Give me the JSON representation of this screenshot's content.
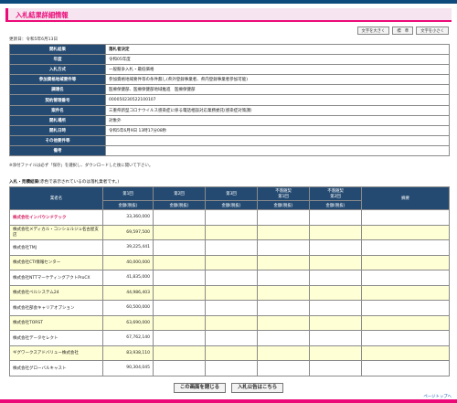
{
  "header": {
    "title": "入札結果詳細情報"
  },
  "font_controls": {
    "larger": "文字を大きく",
    "standard": "標　準",
    "smaller": "文字を小さく"
  },
  "updated": "更新日：令和5年6月13日",
  "info": [
    {
      "label": "開札結果",
      "value": "落札者決定",
      "bold": true
    },
    {
      "label": "年度",
      "value": "令和05年度"
    },
    {
      "label": "入札方式",
      "value": "一般競争入札・最低価格"
    },
    {
      "label": "参加資格地域要件等",
      "value": "参加資格地域要件等の条件無し(県外登録事業者、県内登録事業者参加可能)"
    },
    {
      "label": "調達名",
      "value": "医療保健部、医療保健部地域推進　医療保健部"
    },
    {
      "label": "契約管理番号",
      "value": "000050230522100107"
    },
    {
      "label": "案件名",
      "value": "三重県新型コロナウイルス感染症に係る電話相談対応業務委託(感染症対策課)"
    },
    {
      "label": "開札場所",
      "value": "対象外"
    },
    {
      "label": "開札日時",
      "value": "令和5年6月9日 13時17分08秒"
    },
    {
      "label": "その他要件等",
      "value": ""
    },
    {
      "label": "備考",
      "value": ""
    }
  ],
  "note": "※添付ファイルは必ず「保存」を選択し、ダウンロードした後に開いて下さい。",
  "bids_section": {
    "title": "入札・見積結果",
    "subtitle": "(赤色で表示されているのは落札業者です。)"
  },
  "bids_table": {
    "col_name": "業者名",
    "col_round1": "第1回",
    "col_round2": "第2回",
    "col_round3": "第3回",
    "col_neg1": "不落随契\n第1回",
    "col_neg2": "不落随契\n第2回",
    "col_notes": "摘要",
    "amount_label": "金額(税抜)"
  },
  "bids": [
    {
      "name": "株式会社インバウンドテック",
      "amount": "33,360,000",
      "winner": true,
      "yellow": false
    },
    {
      "name": "株式会社メディカル・コンシェルジュ名古屋支店",
      "amount": "69,597,500",
      "winner": false,
      "yellow": true
    },
    {
      "name": "株式会社TMJ",
      "amount": "39,225,441",
      "winner": false,
      "yellow": false
    },
    {
      "name": "株式会社CTI情報センター",
      "amount": "40,000,000",
      "winner": false,
      "yellow": true
    },
    {
      "name": "株式会社NTTマーケティングアクトProCX",
      "amount": "41,835,000",
      "winner": false,
      "yellow": false
    },
    {
      "name": "株式会社ベルシステム24",
      "amount": "44,986,403",
      "winner": false,
      "yellow": true
    },
    {
      "name": "株式会社部会キャリアオプション",
      "amount": "60,500,000",
      "winner": false,
      "yellow": false
    },
    {
      "name": "株式会社TORST",
      "amount": "63,690,000",
      "winner": false,
      "yellow": true
    },
    {
      "name": "株式会社データセレクト",
      "amount": "67,762,140",
      "winner": false,
      "yellow": false
    },
    {
      "name": "ギグワークスアドバリュー株式会社",
      "amount": "83,938,110",
      "winner": false,
      "yellow": true
    },
    {
      "name": "株式会社グローバルキャスト",
      "amount": "90,304,045",
      "winner": false,
      "yellow": false
    }
  ],
  "buttons": {
    "close": "この画面を閉じる",
    "notice": "入札公告はこちら"
  },
  "pagetop": "ページトップへ",
  "colors": {
    "accent": "#ec0a78",
    "header_bg": "#244a71",
    "winner_text": "#d4145a",
    "row_yellow": "#ffffd6"
  }
}
